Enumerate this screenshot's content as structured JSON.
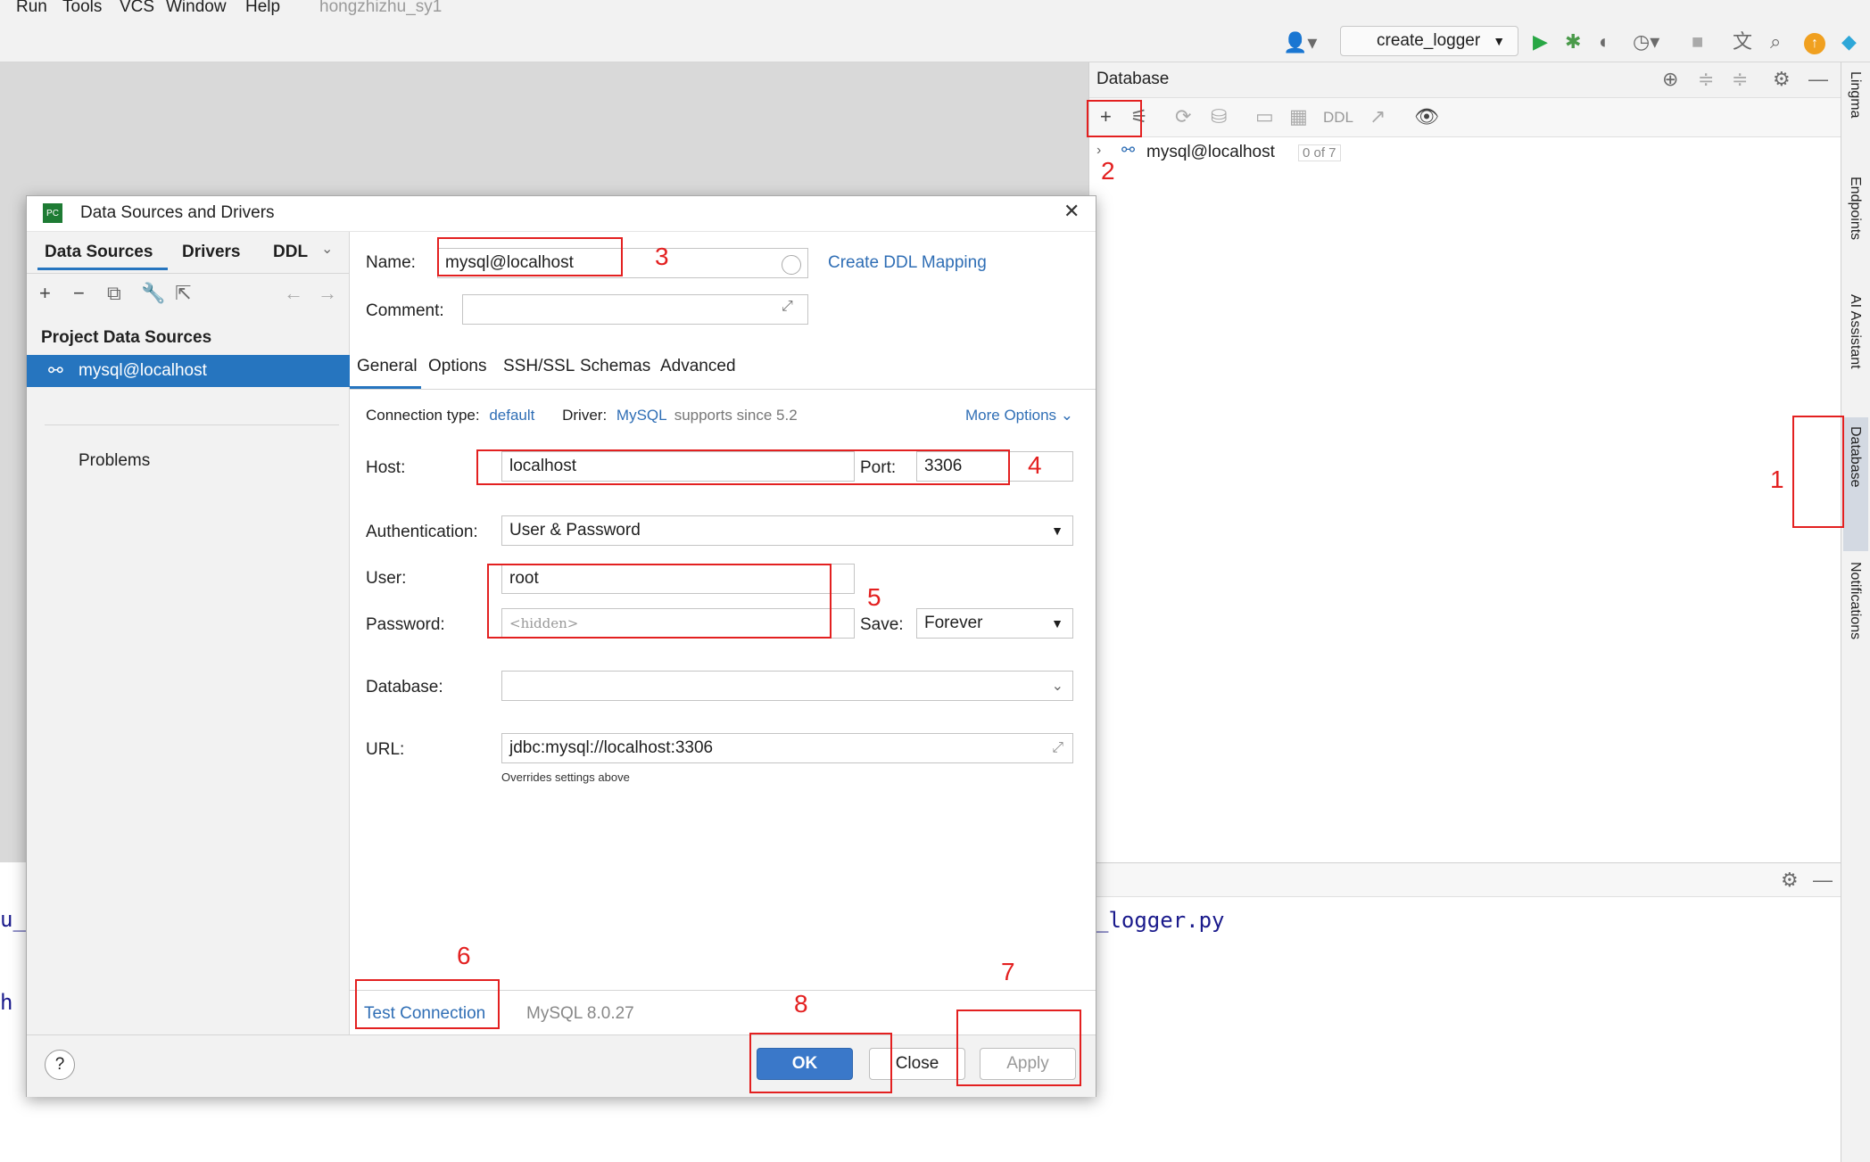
{
  "menu": {
    "run": "Run",
    "tools": "Tools",
    "vcs": "VCS",
    "window": "Window",
    "help": "Help",
    "project": "hongzhizhu_sy1"
  },
  "toolbar": {
    "run_config": "create_logger"
  },
  "db_panel": {
    "title": "Database",
    "ddl": "DDL",
    "tree_item": "mysql@localhost",
    "count": "0 of 7"
  },
  "right_strip": {
    "t1": "Lingma",
    "t2": "Endpoints",
    "t3": "AI Assistant",
    "t4": "Database",
    "t5": "Notifications"
  },
  "code": {
    "left1": "u_",
    "left2": "h",
    "right1": "_logger.py"
  },
  "dialog": {
    "title": "Data Sources and Drivers",
    "left_tabs": [
      "Data Sources",
      "Drivers",
      "DDL"
    ],
    "section": "Project Data Sources",
    "selected": "mysql@localhost",
    "problems": "Problems",
    "name_label": "Name:",
    "name_value": "mysql@localhost",
    "create_ddl": "Create DDL Mapping",
    "comment_label": "Comment:",
    "tabs": [
      "General",
      "Options",
      "SSH/SSL",
      "Schemas",
      "Advanced"
    ],
    "conn_type_label": "Connection type:",
    "conn_type": "default",
    "driver_label": "Driver:",
    "driver": "MySQL",
    "driver_note": "supports since 5.2",
    "more_options": "More Options",
    "host_label": "Host:",
    "host": "localhost",
    "port_label": "Port:",
    "port": "3306",
    "auth_label": "Authentication:",
    "auth": "User & Password",
    "user_label": "User:",
    "user": "root",
    "password_label": "Password:",
    "password_placeholder": "<hidden>",
    "save_label": "Save:",
    "save": "Forever",
    "database_label": "Database:",
    "url_label": "URL:",
    "url": "jdbc:mysql://localhost:3306",
    "url_note": "Overrides settings above",
    "test_connection": "Test Connection",
    "mysql_version": "MySQL 8.0.27",
    "ok": "OK",
    "close": "Close",
    "apply": "Apply",
    "help": "?"
  },
  "annotations": [
    "1",
    "2",
    "3",
    "4",
    "5",
    "6",
    "7",
    "8"
  ],
  "colors": {
    "annotation": "#e32020",
    "link": "#2f6eb5",
    "selected": "#2675bf",
    "ok": "#3a78c9"
  }
}
